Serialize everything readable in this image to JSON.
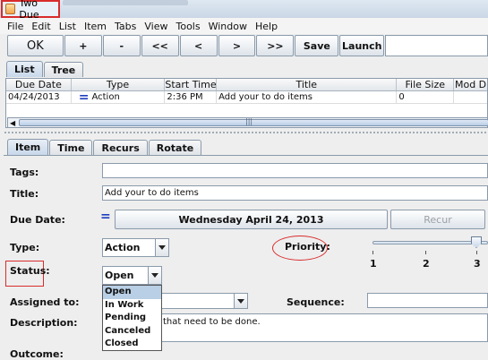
{
  "window": {
    "title": "Two Due"
  },
  "menu": [
    "File",
    "Edit",
    "List",
    "Item",
    "Tabs",
    "View",
    "Tools",
    "Window",
    "Help"
  ],
  "toolbar": {
    "ok": "OK",
    "plus": "+",
    "minus": "-",
    "first": "<<",
    "prev": "<",
    "next": ">",
    "last": ">>",
    "save": "Save",
    "launch": "Launch"
  },
  "list_tabs": [
    "List",
    "Tree"
  ],
  "table": {
    "columns": [
      "Due Date",
      "Type",
      "Start Time",
      "Title",
      "File Size",
      "Mod D"
    ],
    "rows": [
      {
        "due": "04/24/2013",
        "type": "Action",
        "start": "2:36 PM",
        "title": "Add your to do items",
        "size": "0",
        "mod": ""
      }
    ]
  },
  "scroll": {
    "grip": "|||"
  },
  "detail_tabs": [
    "Item",
    "Time",
    "Recurs",
    "Rotate"
  ],
  "form": {
    "tags_label": "Tags:",
    "tags_value": "",
    "title_label": "Title:",
    "title_value": "Add your to do items",
    "due_label": "Due Date:",
    "due_date_button": "Wednesday  April 24, 2013",
    "recur_button": "Recur",
    "type_label": "Type:",
    "type_value": "Action",
    "priority_label": "Priority:",
    "priority_ticks": [
      "1",
      "2",
      "3"
    ],
    "priority_value": 3,
    "status_label": "Status:",
    "status_value": "Open",
    "status_options": [
      "Open",
      "In Work",
      "Pending",
      "Canceled",
      "Closed"
    ],
    "assigned_label": "Assigned to:",
    "sequence_label": "Sequence:",
    "description_label": "Description:",
    "description_value": "that need to be done.",
    "outcome_label": "Outcome:"
  },
  "colors": {
    "highlight_red": "#d92b2b",
    "selection": "#b8cfe5",
    "equals_blue": "#1f3fbf"
  }
}
